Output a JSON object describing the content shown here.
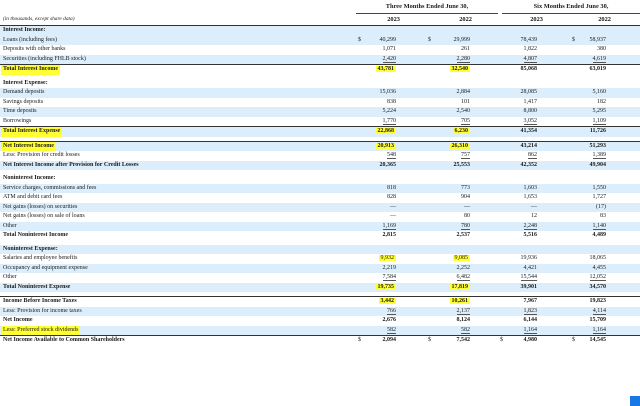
{
  "header": {
    "units_note": "(in thousands, except share data)",
    "period_1": "Three Months Ended June 30,",
    "period_2": "Six Months Ended June 30,",
    "years": [
      "2023",
      "2022",
      "2023",
      "2022"
    ]
  },
  "rows": [
    {
      "label": "Interest Income:",
      "type": "section",
      "shade": true
    },
    {
      "label": "Loans (including fees)",
      "values": [
        "40,299",
        "29,999",
        "78,439",
        "58,937"
      ],
      "currency": [
        "$",
        "$",
        "",
        "$"
      ],
      "shade": true
    },
    {
      "label": "Deposits with other banks",
      "values": [
        "1,071",
        "261",
        "1,822",
        "380"
      ]
    },
    {
      "label": "Securities (including FHLB stock)",
      "values": [
        "2,420",
        "2,280",
        "4,807",
        "4,619"
      ],
      "shade": true,
      "underline": true
    },
    {
      "label": "Total Interest Income",
      "values": [
        "43,781",
        "32,540",
        "85,068",
        "63,019"
      ],
      "bold": true,
      "label_highlight": true,
      "value_highlight": [
        true,
        true,
        false,
        false
      ],
      "strong": true
    },
    {
      "gap": true
    },
    {
      "label": "Interest Expense:",
      "type": "section"
    },
    {
      "label": "Demand deposits",
      "values": [
        "15,036",
        "2,884",
        "28,085",
        "5,160"
      ],
      "shade": true
    },
    {
      "label": "Savings deposits",
      "values": [
        "838",
        "101",
        "1,417",
        "182"
      ]
    },
    {
      "label": "Time deposits",
      "values": [
        "5,224",
        "2,540",
        "8,800",
        "5,295"
      ],
      "shade": true
    },
    {
      "label": "Borrowings",
      "values": [
        "1,770",
        "705",
        "3,052",
        "1,109"
      ],
      "underline": true
    },
    {
      "label": "Total Interest Expense",
      "values": [
        "22,868",
        "6,230",
        "41,354",
        "11,726"
      ],
      "bold": true,
      "label_highlight": true,
      "value_highlight": [
        true,
        true,
        false,
        false
      ],
      "shade": true,
      "strong": true
    },
    {
      "gap": true
    },
    {
      "label": "Net Interest Income",
      "values": [
        "20,913",
        "26,310",
        "43,214",
        "51,293"
      ],
      "bold": true,
      "label_highlight": true,
      "value_highlight": [
        true,
        true,
        false,
        false
      ],
      "shade": true,
      "strong": true
    },
    {
      "label": "Less: Provision for credit losses",
      "values": [
        "548",
        "757",
        "862",
        "1,389"
      ],
      "underline": true
    },
    {
      "label": "Net Interest Income after Provision for Credit Losses",
      "values": [
        "20,365",
        "25,553",
        "42,352",
        "49,904"
      ],
      "bold": true,
      "shade": true
    },
    {
      "gap": true
    },
    {
      "label": "Noninterest Income:",
      "type": "section"
    },
    {
      "label": "Service charges, commissions and fees",
      "values": [
        "818",
        "773",
        "1,603",
        "1,550"
      ],
      "shade": true
    },
    {
      "label": "ATM and debit card fees",
      "values": [
        "828",
        "904",
        "1,653",
        "1,727"
      ]
    },
    {
      "label": "Net gains (losses) on securities",
      "values": [
        "—",
        "—",
        "—",
        "(17)"
      ],
      "shade": true
    },
    {
      "label": "Net gains (losses) on sale of loans",
      "values": [
        "—",
        "80",
        "12",
        "83"
      ]
    },
    {
      "label": "Other",
      "values": [
        "1,169",
        "780",
        "2,248",
        "1,140"
      ],
      "shade": true,
      "underline": true
    },
    {
      "label": "Total Noninterest Income",
      "values": [
        "2,815",
        "2,537",
        "5,516",
        "4,489"
      ],
      "bold": true
    },
    {
      "gap": true
    },
    {
      "label": "Noninterest Expense:",
      "type": "section",
      "shade": true
    },
    {
      "label": "Salaries and employee benefits",
      "values": [
        "9,932",
        "9,085",
        "19,936",
        "18,065"
      ],
      "value_highlight": [
        true,
        true,
        false,
        false
      ]
    },
    {
      "label": "Occupancy and equipment expense",
      "values": [
        "2,219",
        "2,252",
        "4,421",
        "4,455"
      ],
      "shade": true
    },
    {
      "label": "Other",
      "values": [
        "7,584",
        "6,482",
        "15,544",
        "12,052"
      ],
      "underline": true
    },
    {
      "label": "Total Noninterest Expense",
      "values": [
        "19,735",
        "17,819",
        "39,901",
        "34,570"
      ],
      "bold": true,
      "value_highlight": [
        true,
        true,
        false,
        false
      ],
      "shade": true
    },
    {
      "gap": true
    },
    {
      "label": "Income Before Income Taxes",
      "values": [
        "3,442",
        "10,261",
        "7,967",
        "19,823"
      ],
      "bold": true,
      "value_highlight": [
        true,
        true,
        false,
        false
      ],
      "strong": true
    },
    {
      "label": "Less: Provision for income taxes",
      "values": [
        "766",
        "2,137",
        "1,823",
        "4,114"
      ],
      "shade": true,
      "underline": true
    },
    {
      "label": "Net Income",
      "values": [
        "2,676",
        "8,124",
        "6,144",
        "15,709"
      ],
      "bold": true
    },
    {
      "label": "Less: Preferred stock dividends",
      "values": [
        "582",
        "582",
        "1,164",
        "1,164"
      ],
      "label_highlight": true,
      "shade": true,
      "underline": true
    },
    {
      "label": "Net Income Available to Common Shareholders",
      "values": [
        "2,094",
        "7,542",
        "4,980",
        "14,545"
      ],
      "currency": [
        "$",
        "$",
        "$",
        "$"
      ],
      "bold": true,
      "strong": true
    }
  ],
  "colors": {
    "row_shade": "#dceefb",
    "highlight": "#ffff33",
    "corner_marker": "#1677e5"
  }
}
